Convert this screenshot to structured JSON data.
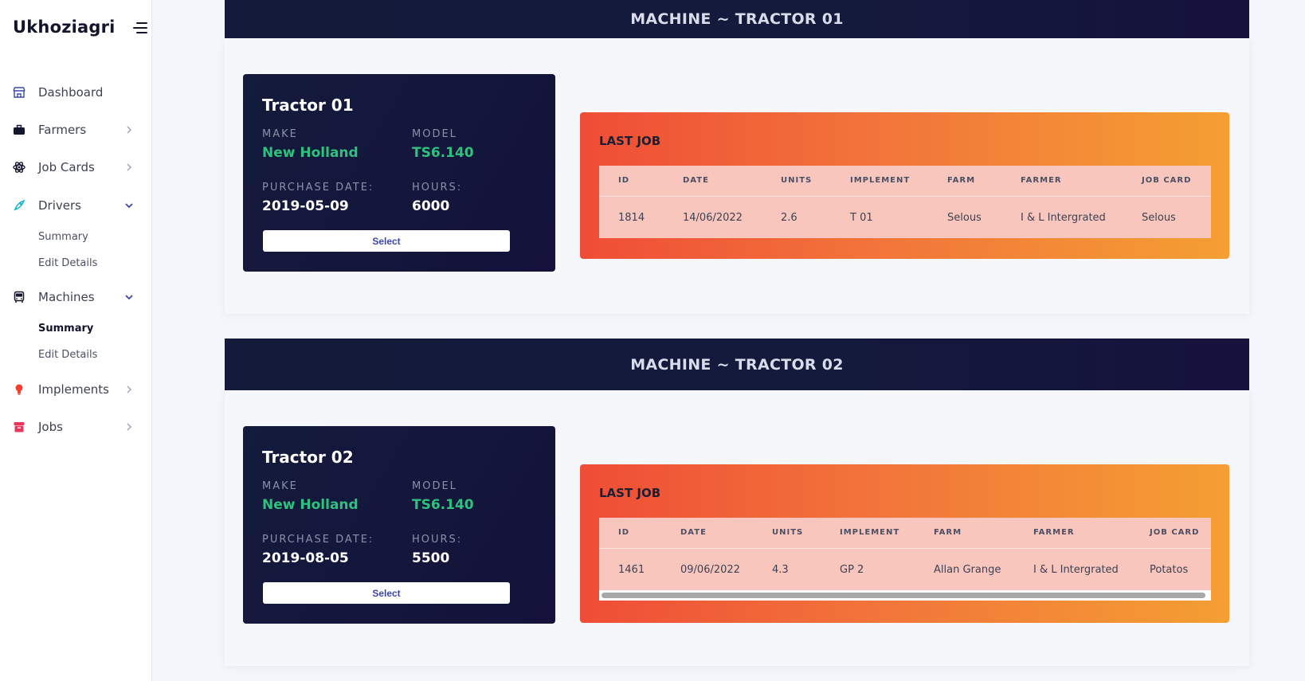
{
  "brand": "Ukhoziagri",
  "sidebar": {
    "items": [
      {
        "label": "Dashboard",
        "icon": "store-icon",
        "color": "#3a47a8"
      },
      {
        "label": "Farmers",
        "icon": "briefcase-icon",
        "color": "#12152b"
      },
      {
        "label": "Job Cards",
        "icon": "atom-icon",
        "color": "#12152b"
      },
      {
        "label": "Drivers",
        "icon": "rocket-icon",
        "color": "#17b5c9"
      },
      {
        "label": "Machines",
        "icon": "bus-icon",
        "color": "#12152b"
      },
      {
        "label": "Implements",
        "icon": "bulb-icon",
        "color": "#f0402f"
      },
      {
        "label": "Jobs",
        "icon": "archive-icon",
        "color": "#e8375a"
      }
    ],
    "drivers_sub": [
      "Summary",
      "Edit Details"
    ],
    "machines_sub": [
      "Summary",
      "Edit Details"
    ]
  },
  "machines": [
    {
      "band_title": "MACHINE ~ TRACTOR 01",
      "name": "Tractor 01",
      "make_label": "MAKE",
      "make": "New Holland",
      "model_label": "MODEL",
      "model": "TS6.140",
      "purchase_label": "PURCHASE DATE:",
      "purchase_date": "2019-05-09",
      "hours_label": "HOURS:",
      "hours": "6000",
      "select_label": "Select",
      "last_job_title": "LAST JOB",
      "headers": [
        "ID",
        "DATE",
        "UNITS",
        "IMPLEMENT",
        "FARM",
        "FARMER",
        "JOB CARD"
      ],
      "row": [
        "1814",
        "14/06/2022",
        "2.6",
        "T 01",
        "Selous",
        "I & L Intergrated",
        "Selous"
      ]
    },
    {
      "band_title": "MACHINE ~ TRACTOR 02",
      "name": "Tractor 02",
      "make_label": "MAKE",
      "make": "New Holland",
      "model_label": "MODEL",
      "model": "TS6.140",
      "purchase_label": "PURCHASE DATE:",
      "purchase_date": "2019-08-05",
      "hours_label": "HOURS:",
      "hours": "5500",
      "select_label": "Select",
      "last_job_title": "LAST JOB",
      "headers": [
        "ID",
        "DATE",
        "UNITS",
        "IMPLEMENT",
        "FARM",
        "FARMER",
        "JOB CARD"
      ],
      "row": [
        "1461",
        "09/06/2022",
        "4.3",
        "GP 2",
        "Allan Grange",
        "I & L Intergrated",
        "Potatos"
      ]
    }
  ]
}
